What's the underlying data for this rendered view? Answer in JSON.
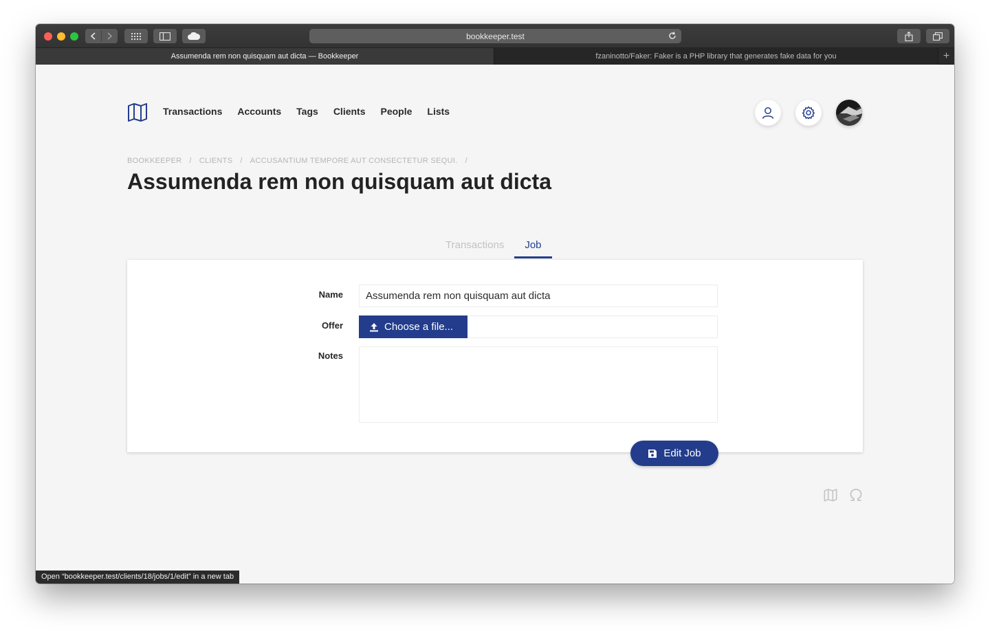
{
  "browser": {
    "url": "bookkeeper.test",
    "tabs": [
      {
        "title": "Assumenda rem non quisquam aut dicta — Bookkeeper",
        "active": true
      },
      {
        "title": "fzaninotto/Faker: Faker is a PHP library that generates fake data for you",
        "active": false
      }
    ],
    "new_tab_label": "+",
    "status_text": "Open “bookkeeper.test/clients/18/jobs/1/edit” in a new tab"
  },
  "nav": {
    "logo_icon": "map-icon",
    "items": [
      "Transactions",
      "Accounts",
      "Tags",
      "Clients",
      "People",
      "Lists"
    ],
    "profile_icon": "user-icon",
    "settings_icon": "gear-icon"
  },
  "breadcrumb": [
    "Bookkeeper",
    "Clients",
    "Accusantium tempore aut consectetur sequi."
  ],
  "breadcrumb_separator": "/",
  "page": {
    "title": "Assumenda rem non quisquam aut dicta",
    "tabs": [
      {
        "label": "Transactions",
        "active": false
      },
      {
        "label": "Job",
        "active": true
      }
    ]
  },
  "form": {
    "name_label": "Name",
    "name_value": "Assumenda rem non quisquam aut dicta",
    "offer_label": "Offer",
    "file_button_label": "Choose a file...",
    "notes_label": "Notes",
    "notes_value": "",
    "submit_label": "Edit Job"
  },
  "footer_icons": [
    "map-icon",
    "omega-icon"
  ],
  "colors": {
    "primary": "#233d8c",
    "background": "#f5f5f5",
    "text": "#232323",
    "muted": "#b5b5b5"
  }
}
